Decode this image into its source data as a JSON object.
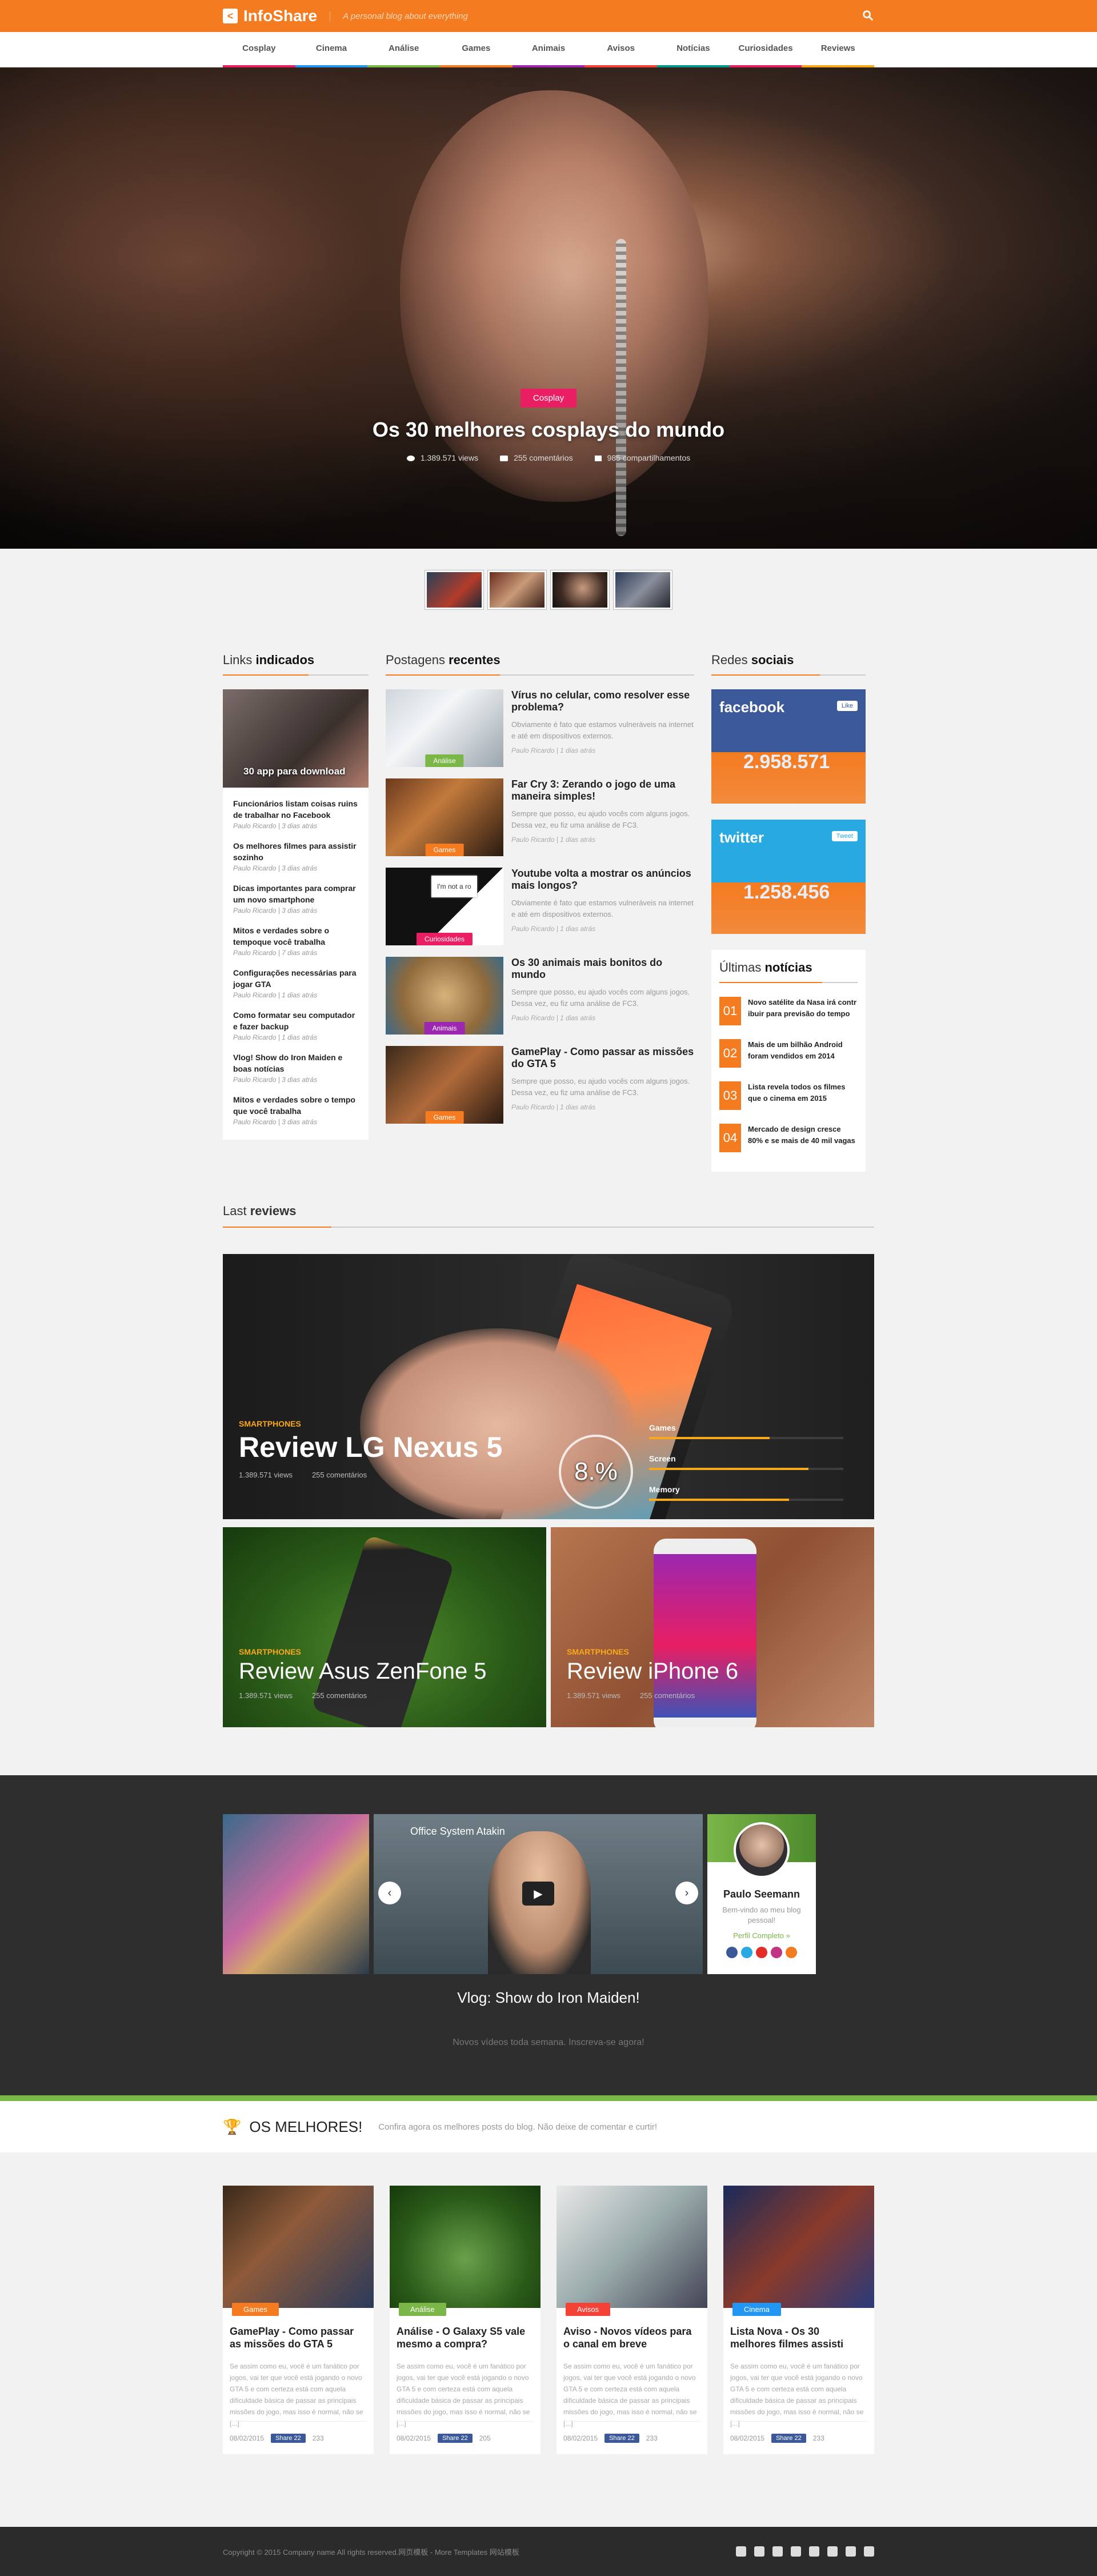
{
  "header": {
    "logo": "InfoShare",
    "tagline": "A personal blog about everything"
  },
  "nav": [
    {
      "label": "Cosplay",
      "color": "#e91e63"
    },
    {
      "label": "Cinema",
      "color": "#2196f3"
    },
    {
      "label": "Análise",
      "color": "#7ab648"
    },
    {
      "label": "Games",
      "color": "#f47b20"
    },
    {
      "label": "Animais",
      "color": "#9c27b0"
    },
    {
      "label": "Avisos",
      "color": "#f44336"
    },
    {
      "label": "Notícias",
      "color": "#009688"
    },
    {
      "label": "Curiosidades",
      "color": "#e91e63"
    },
    {
      "label": "Reviews",
      "color": "#f7a81c"
    }
  ],
  "hero": {
    "category": "Cosplay",
    "title": "Os 30 melhores cosplays do mundo",
    "views": "1.389.571 views",
    "comments": "255 comentários",
    "shares": "985 compartilhamentos"
  },
  "links": {
    "heading_a": "Links",
    "heading_b": "indicados",
    "feature": "30 app para download",
    "items": [
      {
        "t": "Funcionários listam coisas ruins de trabalhar no Facebook",
        "m": "Paulo Ricardo | 3 dias atrás"
      },
      {
        "t": "Os melhores filmes para assistir sozinho",
        "m": "Paulo Ricardo | 3 dias atrás"
      },
      {
        "t": "Dicas importantes para comprar um novo smartphone",
        "m": "Paulo Ricardo | 3 dias atrás"
      },
      {
        "t": "Mitos e verdades sobre o tempoque você trabalha",
        "m": "Paulo Ricardo | 7 dias atrás"
      },
      {
        "t": "Configurações necessárias para jogar GTA",
        "m": "Paulo Ricardo | 1 dias atrás"
      },
      {
        "t": "Como formatar seu computador e fazer backup",
        "m": "Paulo Ricardo | 1 dias atrás"
      },
      {
        "t": "Vlog! Show do Iron Maiden e boas notícias",
        "m": "Paulo Ricardo | 3 dias atrás"
      },
      {
        "t": "Mitos e verdades sobre o tempo que você trabalha",
        "m": "Paulo Ricardo | 3 dias atrás"
      }
    ]
  },
  "posts": {
    "heading_a": "Postagens",
    "heading_b": "recentes",
    "items": [
      {
        "cat": "Análise",
        "color": "#7ab648",
        "t": "Vírus no celular, como resolver esse problema?",
        "d": "Obviamente é fato que estamos vulneráveis na internet e até em dispositivos externos.",
        "m": "Paulo Ricardo | 1 dias atrás"
      },
      {
        "cat": "Games",
        "color": "#f47b20",
        "t": "Far Cry 3: Zerando o jogo de uma maneira simples!",
        "d": "Sempre que posso, eu ajudo vocês com alguns jogos. Dessa vez, eu fiz uma análise de FC3.",
        "m": "Paulo Ricardo | 1 dias atrás"
      },
      {
        "cat": "Curiosidades",
        "color": "#e91e63",
        "t": "Youtube volta a mostrar os anúncios mais longos?",
        "d": "Obviamente é fato que estamos vulneráveis na internet e até em dispositivos externos.",
        "m": "Paulo Ricardo | 1 dias atrás",
        "extra": "I'm not a ro"
      },
      {
        "cat": "Animais",
        "color": "#9c27b0",
        "t": "Os 30 animais mais bonitos do mundo",
        "d": "Sempre que posso, eu ajudo vocês com alguns jogos. Dessa vez, eu fiz uma análise de FC3.",
        "m": "Paulo Ricardo | 1 dias atrás"
      },
      {
        "cat": "Games",
        "color": "#f47b20",
        "t": "GamePlay - Como passar as missões do GTA 5",
        "d": "Sempre que posso, eu ajudo vocês com alguns jogos. Dessa vez, eu fiz uma análise de FC3.",
        "m": "Paulo Ricardo | 1 dias atrás"
      }
    ]
  },
  "social": {
    "heading_a": "Redes",
    "heading_b": "sociais",
    "facebook": {
      "name": "facebook",
      "count": "2.958.571",
      "button": "Like",
      "color": "#3b5998"
    },
    "twitter": {
      "name": "twitter",
      "count": "1.258.456",
      "button": "Tweet",
      "color": "#29a9e1"
    }
  },
  "news": {
    "heading_a": "Últimas",
    "heading_b": "notícias",
    "items": [
      {
        "n": "01",
        "t": "Novo satélite da Nasa irá contr ibuir para previsão do tempo"
      },
      {
        "n": "02",
        "t": "Mais de um bilhão Android foram vendidos em 2014"
      },
      {
        "n": "03",
        "t": "Lista revela todos os filmes que o cinema em 2015"
      },
      {
        "n": "04",
        "t": "Mercado de design cresce 80% e se mais de 40 mil vagas"
      }
    ]
  },
  "reviews": {
    "heading_a": "Last",
    "heading_b": "reviews",
    "main": {
      "cat": "SMARTPHONES",
      "title": "Review LG Nexus 5",
      "views": "1.389.571 views",
      "comments": "255 comentários",
      "score": "8.%",
      "bars": [
        {
          "label": "Games",
          "value": 0.62
        },
        {
          "label": "Screen",
          "value": 0.82
        },
        {
          "label": "Memory",
          "value": 0.72
        }
      ]
    },
    "small": [
      {
        "cat": "SMARTPHONES",
        "title": "Review Asus ZenFone 5",
        "views": "1.389.571 views",
        "comments": "255 comentários"
      },
      {
        "cat": "SMARTPHONES",
        "title": "Review iPhone 6",
        "views": "1.389.571 views",
        "comments": "255 comentários"
      }
    ]
  },
  "vlog": {
    "video_caption": "Office System Atakin",
    "title": "Vlog: Show do Iron Maiden!",
    "subtitle": "Novos vídeos toda semana. Inscreva-se agora!",
    "profile": {
      "name": "Paulo Seemann",
      "text": "Bem-vindo ao meu blog pessoal!",
      "link": "Perfil Completo »"
    }
  },
  "melhores": {
    "title": "OS MELHORES!",
    "subtitle": "Confira agora os melhores posts do blog. Não deixe de comentar e curtir!",
    "cards": [
      {
        "cat": "Games",
        "color": "#f47b20",
        "t": "GamePlay - Como passar as missões do GTA 5",
        "d": "Se assim como eu, você é um fanático por jogos, vai ter que você está jogando o novo GTA 5 e com certeza está com aquela dificuldade básica de passar as principais missões do jogo, mas isso é normal, não se [...]",
        "date": "08/02/2015",
        "share": "Share 22",
        "comments": "233"
      },
      {
        "cat": "Análise",
        "color": "#7ab648",
        "t": "Análise - O Galaxy S5 vale mesmo a compra?",
        "d": "Se assim como eu, você é um fanático por jogos, vai ter que você está jogando o novo GTA 5 e com certeza está com aquela dificuldade básica de passar as principais missões do jogo, mas isso é normal, não se [...]",
        "date": "08/02/2015",
        "share": "Share 22",
        "comments": "205"
      },
      {
        "cat": "Avisos",
        "color": "#f44336",
        "t": "Aviso - Novos vídeos para o canal em breve",
        "d": "Se assim como eu, você é um fanático por jogos, vai ter que você está jogando o novo GTA 5 e com certeza está com aquela dificuldade básica de passar as principais missões do jogo, mas isso é normal, não se [...]",
        "date": "08/02/2015",
        "share": "Share 22",
        "comments": "233"
      },
      {
        "cat": "Cinema",
        "color": "#2196f3",
        "t": "Lista Nova - Os 30 melhores filmes assisti",
        "d": "Se assim como eu, você é um fanático por jogos, vai ter que você está jogando o novo GTA 5 e com certeza está com aquela dificuldade básica de passar as principais missões do jogo, mas isso é normal, não se [...]",
        "date": "08/02/2015",
        "share": "Share 22",
        "comments": "233"
      }
    ]
  },
  "footer": {
    "copyright": "Copyright © 2015 Company name All rights reserved.网页模板 - More Templates 网站模板"
  }
}
